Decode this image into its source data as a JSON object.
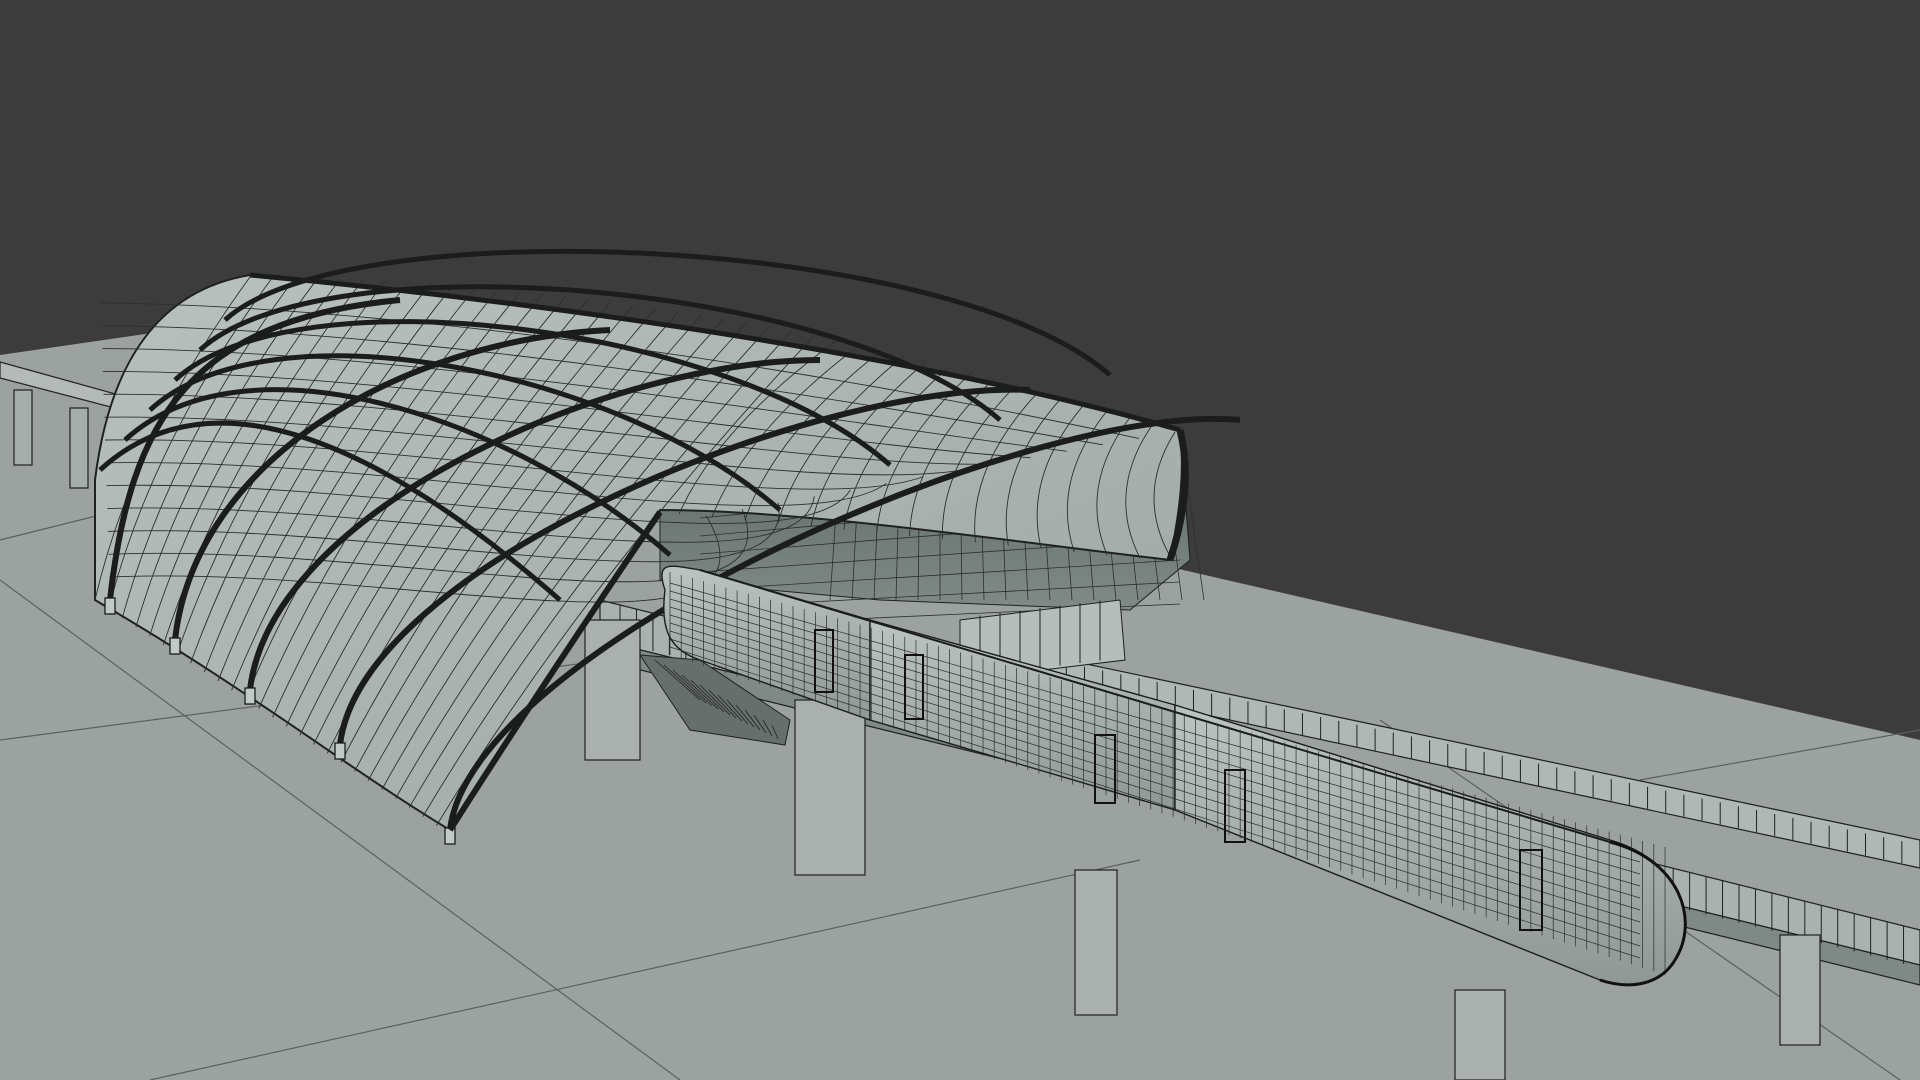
{
  "scene": {
    "background_color": "#3c3c3c",
    "ground_color": "#9aa19e",
    "wire_color": "#1c1f1e",
    "shell_fill": "#aeb6b3",
    "interior_fill": "#6f7a77",
    "train_fill": "#a9b1ae",
    "render_mode": "wireframe-on-shaded"
  }
}
